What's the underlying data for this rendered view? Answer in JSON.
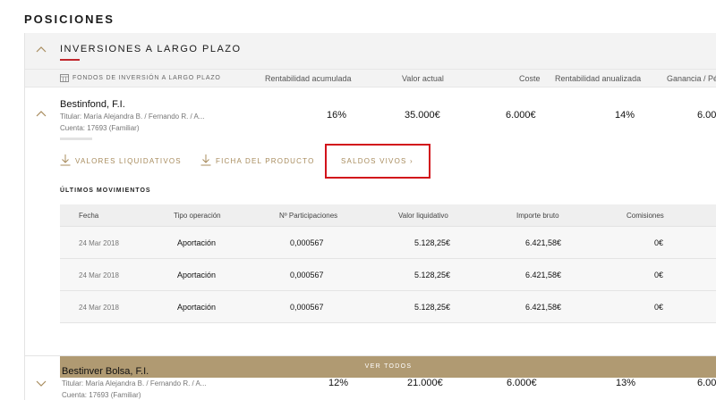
{
  "page": {
    "title": "POSICIONES"
  },
  "section": {
    "title": "INVERSIONES A LARGO PLAZO"
  },
  "columns": {
    "category": "FONDOS DE INVERSIÓN A LARGO PLAZO",
    "rentabilidad_acumulada": "Rentabilidad acumulada",
    "valor_actual": "Valor actual",
    "coste": "Coste",
    "rentabilidad_anualizada": "Rentabilidad anualizada",
    "ganancia": "Ganancia / Pér"
  },
  "funds": [
    {
      "name": "Bestinfond, F.I.",
      "titular": "Titular: María Alejandra B. / Fernando R. / A...",
      "cuenta": "Cuenta: 17693 (Familiar)",
      "rentabilidad_acumulada": "16%",
      "valor_actual": "35.000€",
      "coste": "6.000€",
      "rentabilidad_anualizada": "14%",
      "ganancia": "6.00"
    },
    {
      "name": "Bestinver Bolsa, F.I.",
      "titular": "Titular: María Alejandra B. / Fernando R. / A...",
      "cuenta": "Cuenta: 17693 (Familiar)",
      "rentabilidad_acumulada": "12%",
      "valor_actual": "21.000€",
      "coste": "6.000€",
      "rentabilidad_anualizada": "13%",
      "ganancia": "6.00"
    }
  ],
  "actions": {
    "valores_liquidativos": "VALORES LIQUIDATIVOS",
    "ficha_producto": "FICHA DEL PRODUCTO",
    "saldos_vivos": "SALDOS VIVOS  ›"
  },
  "movements": {
    "title": "ÚLTIMOS MOVIMIENTOS",
    "headers": {
      "fecha": "Fecha",
      "tipo": "Tipo operación",
      "participaciones": "Nº Participaciones",
      "valor_liquidativo": "Valor liquidativo",
      "importe_bruto": "Importe bruto",
      "comisiones": "Comisiones"
    },
    "rows": [
      {
        "fecha": "24 Mar 2018",
        "tipo": "Aportación",
        "participaciones": "0,000567",
        "valor_liquidativo": "5.128,25€",
        "importe_bruto": "6.421,58€",
        "comisiones": "0€"
      },
      {
        "fecha": "24 Mar 2018",
        "tipo": "Aportación",
        "participaciones": "0,000567",
        "valor_liquidativo": "5.128,25€",
        "importe_bruto": "6.421,58€",
        "comisiones": "0€"
      },
      {
        "fecha": "24 Mar 2018",
        "tipo": "Aportación",
        "participaciones": "0,000567",
        "valor_liquidativo": "5.128,25€",
        "importe_bruto": "6.421,58€",
        "comisiones": "0€"
      }
    ],
    "ver_todos": "VER TODOS"
  },
  "colors": {
    "accent_gold": "#a88c5e",
    "button_gold": "#b09a72",
    "brand_red": "#c0272d",
    "highlight_red": "#d2121b"
  },
  "icons": {
    "section_toggle": "chevron-up-icon",
    "fund1_toggle": "chevron-up-icon",
    "fund2_toggle": "chevron-down-icon",
    "category": "calculator-icon",
    "download": "download-icon"
  }
}
